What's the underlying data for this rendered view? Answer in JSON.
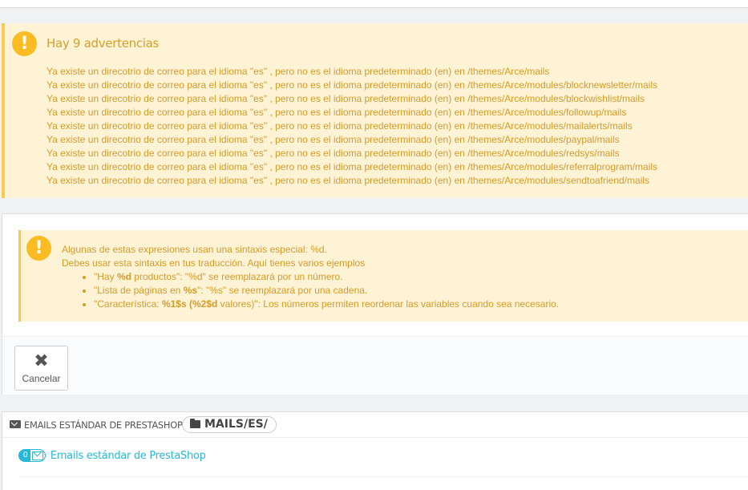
{
  "warnings": {
    "title": "Hay 9 advertencias",
    "icon": "exclamation-icon",
    "color": "#d69a27",
    "items": [
      "Ya existe un direcotrio de correo para el idioma \"es\" , pero no es el idioma predeterminado (en) en /themes/Arce/mails",
      "Ya existe un direcotrio de correo para el idioma \"es\" , pero no es el idioma predeterminado (en) en /themes/Arce/modules/blocknewsletter/mails",
      "Ya existe un direcotrio de correo para el idioma \"es\" , pero no es el idioma predeterminado (en) en /themes/Arce/modules/blockwishlist/mails",
      "Ya existe un direcotrio de correo para el idioma \"es\" , pero no es el idioma predeterminado (en) en /themes/Arce/modules/followup/mails",
      "Ya existe un direcotrio de correo para el idioma \"es\" , pero no es el idioma predeterminado (en) en /themes/Arce/modules/mailalerts/mails",
      "Ya existe un direcotrio de correo para el idioma \"es\" , pero no es el idioma predeterminado (en) en /themes/Arce/modules/paypal/mails",
      "Ya existe un direcotrio de correo para el idioma \"es\" , pero no es el idioma predeterminado (en) en /themes/Arce/modules/redsys/mails",
      "Ya existe un direcotrio de correo para el idioma \"es\" , pero no es el idioma predeterminado (en) en /themes/Arce/modules/referralprogram/mails",
      "Ya existe un direcotrio de correo para el idioma \"es\" , pero no es el idioma predeterminado (en) en /themes/Arce/modules/sendtoafriend/mails"
    ]
  },
  "info": {
    "icon": "exclamation-icon",
    "line1": "Algunas de estas expresiones usan una sintaxis especial: %d.",
    "line2": "Debes usar esta sintaxis en tus traducción. Aquí tienes varios ejemplos",
    "examples": [
      {
        "pre": "\"Hay ",
        "bold": "%d",
        "post": " productos\": \"%d\" se reemplazará por un número."
      },
      {
        "pre": "\"Lista de páginas en ",
        "bold": "%s",
        "post": "\": \"%s\" se reemplazará por una cadena."
      },
      {
        "pre": "\"Característica: ",
        "bold": "%1$s (%2$d",
        "post": " valores)\": Los números permiten reordenar las variables cuando sea necesario."
      }
    ]
  },
  "toolbar": {
    "cancel_label": "Cancelar",
    "cancel_icon": "close-icon"
  },
  "emails": {
    "header_icon": "envelope-icon",
    "header_title": "EMAILS ESTÁNDAR DE PRESTASHOP",
    "path_icon": "folder-icon",
    "path_label": "MAILS/ES/",
    "link_count": "0",
    "link_icon": "envelope-icon",
    "link_label": "Emails estándar de PrestaShop",
    "accent": "#25b9d7"
  }
}
